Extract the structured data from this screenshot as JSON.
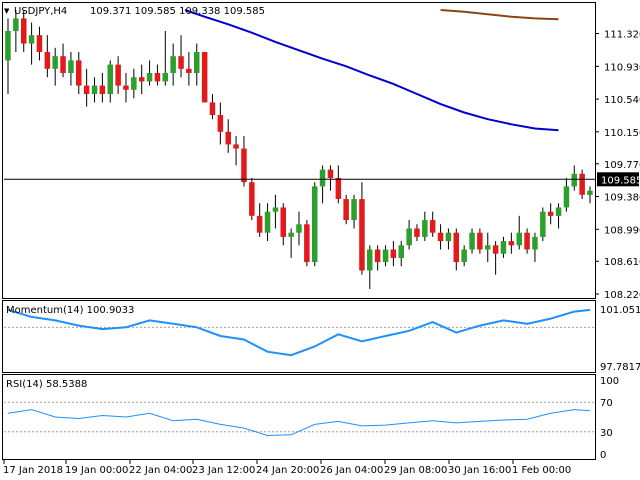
{
  "header": {
    "symbol_label": "USDJPY,H4",
    "ohlc_label": "109.371 109.585 109.338 109.585"
  },
  "momentum": {
    "label": "Momentum(14) 100.9033",
    "ticks": [
      "101.0519",
      "97.7817"
    ]
  },
  "rsi": {
    "label": "RSI(14) 58.5388",
    "ticks": [
      "100",
      "70",
      "30",
      "0"
    ]
  },
  "price_axis": {
    "ticks": [
      "111.320",
      "110.930",
      "110.540",
      "110.150",
      "109.770",
      "109.380",
      "108.990",
      "108.610",
      "108.220"
    ],
    "current_price": "109.585"
  },
  "time_axis": {
    "labels": [
      "17 Jan 2018",
      "19 Jan 00:00",
      "22 Jan 04:00",
      "23 Jan 12:00",
      "24 Jan 20:00",
      "26 Jan 04:00",
      "29 Jan 08:00",
      "30 Jan 16:00",
      "1 Feb 00:00"
    ]
  },
  "colors": {
    "bull": "#2ca02c",
    "bear": "#e31a1c",
    "ma_fast": "#0000cd",
    "ma_slow": "#8b4513",
    "indicator": "#1e90ff",
    "grid_level": "#a0a0a0",
    "frame": "#000000"
  },
  "chart_data": [
    {
      "type": "candlestick",
      "symbol": "USDJPY",
      "timeframe": "H4",
      "ylim": [
        108.22,
        111.6
      ],
      "x_labels": [
        "17 Jan 2018",
        "19 Jan 00:00",
        "22 Jan 04:00",
        "23 Jan 12:00",
        "24 Jan 20:00",
        "26 Jan 04:00",
        "29 Jan 08:00",
        "30 Jan 16:00",
        "1 Feb 00:00"
      ],
      "candles": [
        [
          111.0,
          111.5,
          110.6,
          111.35
        ],
        [
          111.35,
          111.6,
          111.1,
          111.5
        ],
        [
          111.5,
          111.6,
          111.1,
          111.2
        ],
        [
          111.2,
          111.45,
          110.95,
          111.3
        ],
        [
          111.3,
          111.4,
          111.0,
          111.1
        ],
        [
          111.1,
          111.3,
          110.8,
          110.9
        ],
        [
          110.9,
          111.15,
          110.7,
          111.05
        ],
        [
          111.05,
          111.2,
          110.8,
          110.85
        ],
        [
          110.85,
          111.1,
          110.7,
          111.0
        ],
        [
          111.0,
          111.1,
          110.6,
          110.7
        ],
        [
          110.7,
          110.9,
          110.45,
          110.6
        ],
        [
          110.6,
          110.8,
          110.5,
          110.7
        ],
        [
          110.7,
          110.85,
          110.5,
          110.6
        ],
        [
          110.6,
          111.0,
          110.5,
          110.95
        ],
        [
          110.95,
          111.05,
          110.6,
          110.7
        ],
        [
          110.7,
          110.85,
          110.5,
          110.65
        ],
        [
          110.65,
          110.9,
          110.55,
          110.8
        ],
        [
          110.8,
          110.95,
          110.6,
          110.75
        ],
        [
          110.75,
          111.0,
          110.7,
          110.85
        ],
        [
          110.85,
          110.95,
          110.7,
          110.75
        ],
        [
          110.75,
          111.35,
          110.7,
          110.85
        ],
        [
          110.85,
          111.2,
          110.7,
          111.05
        ],
        [
          111.05,
          111.3,
          110.8,
          110.9
        ],
        [
          110.9,
          111.1,
          110.7,
          110.85
        ],
        [
          110.85,
          111.2,
          110.7,
          111.1
        ],
        [
          111.1,
          111.1,
          110.5,
          110.5
        ],
        [
          110.5,
          110.6,
          110.3,
          110.35
        ],
        [
          110.35,
          110.5,
          110.0,
          110.15
        ],
        [
          110.15,
          110.3,
          109.9,
          110.0
        ],
        [
          110.0,
          110.1,
          109.75,
          109.95
        ],
        [
          109.95,
          110.1,
          109.5,
          109.55
        ],
        [
          109.55,
          109.6,
          109.1,
          109.15
        ],
        [
          109.15,
          109.3,
          108.9,
          108.95
        ],
        [
          108.95,
          109.3,
          108.85,
          109.2
        ],
        [
          109.2,
          109.4,
          109.0,
          109.25
        ],
        [
          109.25,
          109.3,
          108.8,
          108.9
        ],
        [
          108.9,
          109.0,
          108.65,
          108.95
        ],
        [
          108.95,
          109.2,
          108.8,
          109.05
        ],
        [
          109.05,
          109.1,
          108.55,
          108.6
        ],
        [
          108.6,
          109.55,
          108.55,
          109.5
        ],
        [
          109.5,
          109.75,
          109.3,
          109.7
        ],
        [
          109.7,
          109.75,
          109.45,
          109.6
        ],
        [
          109.6,
          109.75,
          109.3,
          109.35
        ],
        [
          109.35,
          109.4,
          109.05,
          109.1
        ],
        [
          109.1,
          109.4,
          109.0,
          109.35
        ],
        [
          109.35,
          109.55,
          108.45,
          108.5
        ],
        [
          108.5,
          108.8,
          108.28,
          108.75
        ],
        [
          108.75,
          108.8,
          108.5,
          108.6
        ],
        [
          108.6,
          108.8,
          108.55,
          108.75
        ],
        [
          108.75,
          108.85,
          108.55,
          108.65
        ],
        [
          108.65,
          108.85,
          108.55,
          108.8
        ],
        [
          108.8,
          109.1,
          108.75,
          109.0
        ],
        [
          109.0,
          109.05,
          108.85,
          108.9
        ],
        [
          108.9,
          109.2,
          108.85,
          109.1
        ],
        [
          109.1,
          109.2,
          108.9,
          108.95
        ],
        [
          108.95,
          109.05,
          108.75,
          108.85
        ],
        [
          108.85,
          109.0,
          108.75,
          108.95
        ],
        [
          108.95,
          109.0,
          108.5,
          108.6
        ],
        [
          108.6,
          108.8,
          108.55,
          108.75
        ],
        [
          108.75,
          109.0,
          108.7,
          108.95
        ],
        [
          108.95,
          109.0,
          108.7,
          108.75
        ],
        [
          108.75,
          108.95,
          108.6,
          108.8
        ],
        [
          108.8,
          108.85,
          108.45,
          108.7
        ],
        [
          108.7,
          108.9,
          108.65,
          108.85
        ],
        [
          108.85,
          108.95,
          108.7,
          108.8
        ],
        [
          108.8,
          109.15,
          108.75,
          108.95
        ],
        [
          108.95,
          109.0,
          108.7,
          108.75
        ],
        [
          108.75,
          108.95,
          108.6,
          108.9
        ],
        [
          108.9,
          109.25,
          108.85,
          109.2
        ],
        [
          109.2,
          109.3,
          109.05,
          109.15
        ],
        [
          109.15,
          109.3,
          109.0,
          109.25
        ],
        [
          109.25,
          109.6,
          109.2,
          109.5
        ],
        [
          109.5,
          109.75,
          109.45,
          109.65
        ],
        [
          109.65,
          109.7,
          109.35,
          109.4
        ],
        [
          109.4,
          109.5,
          109.3,
          109.45
        ]
      ],
      "moving_averages": [
        {
          "values": [
            [
              22.5,
              111.6
            ],
            [
              25,
              111.52
            ],
            [
              28,
              111.43
            ],
            [
              31,
              111.33
            ],
            [
              34,
              111.22
            ],
            [
              37,
              111.12
            ],
            [
              40,
              111.02
            ],
            [
              43,
              110.93
            ],
            [
              46,
              110.82
            ],
            [
              49,
              110.72
            ],
            [
              52,
              110.6
            ],
            [
              55,
              110.48
            ],
            [
              58,
              110.38
            ],
            [
              61,
              110.3
            ],
            [
              64,
              110.24
            ],
            [
              67,
              110.19
            ],
            [
              70,
              110.17
            ]
          ]
        },
        {
          "values": [
            [
              55,
              111.6
            ],
            [
              58,
              111.58
            ],
            [
              61,
              111.55
            ],
            [
              64,
              111.52
            ],
            [
              67,
              111.5
            ],
            [
              70,
              111.49
            ]
          ]
        }
      ],
      "current_price": 109.585
    },
    {
      "type": "line",
      "name": "Momentum(14)",
      "ylim": [
        97.7817,
        101.0519
      ],
      "levels": [
        100
      ],
      "x": [
        0,
        3,
        6,
        9,
        12,
        15,
        18,
        21,
        24,
        27,
        30,
        33,
        36,
        39,
        42,
        45,
        48,
        51,
        54,
        57,
        60,
        63,
        66,
        69,
        72,
        74
      ],
      "values": [
        101.0,
        100.6,
        100.4,
        100.1,
        99.9,
        100.0,
        100.4,
        100.2,
        100.0,
        99.5,
        99.3,
        98.6,
        98.4,
        98.9,
        99.6,
        99.2,
        99.5,
        99.8,
        100.3,
        99.7,
        100.1,
        100.4,
        100.2,
        100.5,
        100.9,
        101.0
      ]
    },
    {
      "type": "line",
      "name": "RSI(14)",
      "ylim": [
        0,
        100
      ],
      "levels": [
        70,
        30
      ],
      "x": [
        0,
        3,
        6,
        9,
        12,
        15,
        18,
        21,
        24,
        27,
        30,
        33,
        36,
        39,
        42,
        45,
        48,
        51,
        54,
        57,
        60,
        63,
        66,
        69,
        72,
        74
      ],
      "values": [
        55,
        60,
        50,
        48,
        52,
        50,
        55,
        45,
        47,
        40,
        35,
        25,
        26,
        40,
        44,
        38,
        39,
        42,
        45,
        42,
        44,
        46,
        47,
        55,
        60,
        58.5
      ]
    }
  ]
}
